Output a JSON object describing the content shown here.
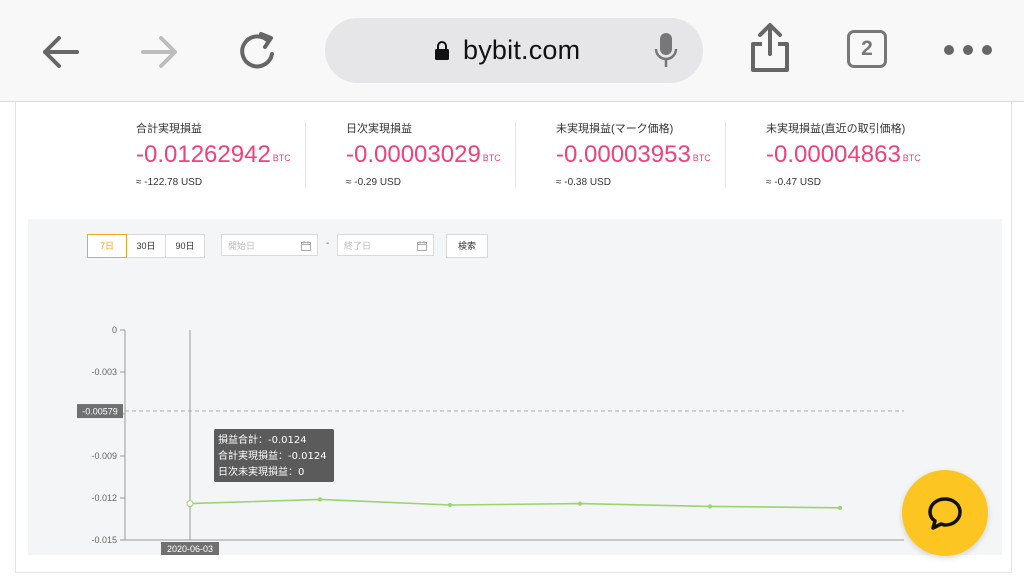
{
  "browser": {
    "url": "bybit.com",
    "tab_count": "2"
  },
  "stats": [
    {
      "label": "合計実現損益",
      "value": "-0.01262942",
      "unit": "BTC",
      "usd": "≈ -122.78 USD"
    },
    {
      "label": "日次実現損益",
      "value": "-0.00003029",
      "unit": "BTC",
      "usd": "≈ -0.29 USD"
    },
    {
      "label": "未実現損益(マーク価格)",
      "value": "-0.00003953",
      "unit": "BTC",
      "usd": "≈ -0.38 USD"
    },
    {
      "label": "未実現損益(直近の取引価格)",
      "value": "-0.00004863",
      "unit": "BTC",
      "usd": "≈ -0.47 USD"
    }
  ],
  "filters": {
    "ranges": [
      "7日",
      "30日",
      "90日"
    ],
    "active_range": "7日",
    "start_placeholder": "開始日",
    "end_placeholder": "終了日",
    "separator": "-",
    "search_label": "検索"
  },
  "chart_data": {
    "type": "line",
    "y_ticks": [
      "0",
      "-0.003",
      "-0.006",
      "-0.009",
      "-0.012",
      "-0.015"
    ],
    "y_tick_values": [
      0,
      -0.003,
      -0.006,
      -0.009,
      -0.012,
      -0.015
    ],
    "ylim": [
      -0.015,
      0
    ],
    "series": [
      {
        "values": [
          -0.0124,
          -0.0121,
          -0.0125,
          -0.0124,
          -0.0126,
          -0.0127
        ],
        "color": "#9bd46f"
      }
    ],
    "crosshair": {
      "index": 0,
      "x_label": "2020-06-03",
      "y_label": "-0.00579",
      "y_value": -0.00579
    },
    "tooltip": [
      "損益合計：-0.0124",
      "合計実現損益：-0.0124",
      "日次未実現損益：0"
    ],
    "grid": false
  }
}
